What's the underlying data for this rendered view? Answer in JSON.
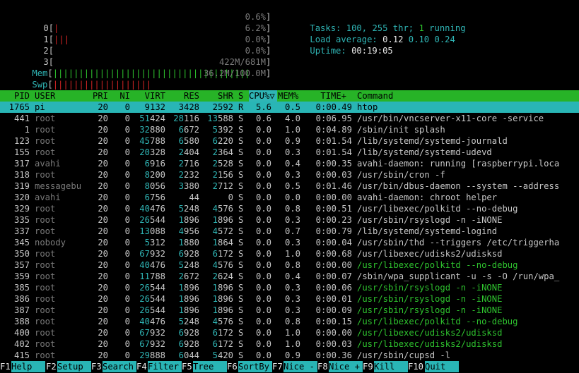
{
  "meters": {
    "cpu": [
      {
        "label": "0",
        "bar": "|",
        "pct": "0.6%"
      },
      {
        "label": "1",
        "bar": "|||",
        "pct": "6.2%"
      },
      {
        "label": "2",
        "bar": "",
        "pct": "0.0%"
      },
      {
        "label": "3",
        "bar": "",
        "pct": "0.0%"
      }
    ],
    "mem": {
      "label": "Mem",
      "bar": "||||||||||||||||||||||||||||||||||||||",
      "value": "422M/681M"
    },
    "swp": {
      "label": "Swp",
      "bar": "|||||||||||||||||||",
      "value": "36.2M/100.0M"
    }
  },
  "stats": {
    "tasks_label": "Tasks: ",
    "tasks": "100",
    "thr": "255",
    "thr_label": " thr; ",
    "running": "1",
    "running_label": " running",
    "load_label": "Load average: ",
    "load1": "0.12",
    "load5": "0.10",
    "load15": "0.24",
    "uptime_label": "Uptime: ",
    "uptime": "00:19:05"
  },
  "columns": [
    "PID",
    "USER",
    "PRI",
    "NI",
    "VIRT",
    "RES",
    "SHR",
    "S",
    "CPU%",
    "MEM%",
    "TIME+",
    "Command"
  ],
  "sort_indicator": "▽",
  "processes": [
    {
      "pid": "1765",
      "user": "pi",
      "pri": "20",
      "ni": "0",
      "virt": "9132",
      "res": "3428",
      "shr": "2592",
      "s": "R",
      "cpu": "5.6",
      "mem": "0.5",
      "time": "0:00.49",
      "cmd": "htop",
      "selected": true
    },
    {
      "pid": "441",
      "user": "root",
      "pri": "20",
      "ni": "0",
      "virt": "51424",
      "res": "28116",
      "shr": "13588",
      "s": "S",
      "cpu": "0.6",
      "mem": "4.0",
      "time": "0:06.95",
      "cmd": "/usr/bin/vncserver-x11-core -service",
      "thread": false
    },
    {
      "pid": "1",
      "user": "root",
      "pri": "20",
      "ni": "0",
      "virt": "32880",
      "res": "6672",
      "shr": "5392",
      "s": "S",
      "cpu": "0.0",
      "mem": "1.0",
      "time": "0:04.89",
      "cmd": "/sbin/init splash",
      "thread": false
    },
    {
      "pid": "123",
      "user": "root",
      "pri": "20",
      "ni": "0",
      "virt": "45788",
      "res": "6580",
      "shr": "6220",
      "s": "S",
      "cpu": "0.0",
      "mem": "0.9",
      "time": "0:01.54",
      "cmd": "/lib/systemd/systemd-journald",
      "thread": false
    },
    {
      "pid": "155",
      "user": "root",
      "pri": "20",
      "ni": "0",
      "virt": "20328",
      "res": "2404",
      "shr": "2364",
      "s": "S",
      "cpu": "0.0",
      "mem": "0.3",
      "time": "0:01.54",
      "cmd": "/lib/systemd/systemd-udevd",
      "thread": false
    },
    {
      "pid": "317",
      "user": "avahi",
      "pri": "20",
      "ni": "0",
      "virt": "6916",
      "res": "2716",
      "shr": "2528",
      "s": "S",
      "cpu": "0.0",
      "mem": "0.4",
      "time": "0:00.35",
      "cmd": "avahi-daemon: running [raspberrypi.loca",
      "thread": false
    },
    {
      "pid": "318",
      "user": "root",
      "pri": "20",
      "ni": "0",
      "virt": "8200",
      "res": "2232",
      "shr": "2156",
      "s": "S",
      "cpu": "0.0",
      "mem": "0.3",
      "time": "0:00.03",
      "cmd": "/usr/sbin/cron -f",
      "thread": false
    },
    {
      "pid": "319",
      "user": "messagebu",
      "pri": "20",
      "ni": "0",
      "virt": "8056",
      "res": "3380",
      "shr": "2712",
      "s": "S",
      "cpu": "0.0",
      "mem": "0.5",
      "time": "0:01.46",
      "cmd": "/usr/bin/dbus-daemon --system --address",
      "thread": false
    },
    {
      "pid": "320",
      "user": "avahi",
      "pri": "20",
      "ni": "0",
      "virt": "6756",
      "res": "44",
      "shr": "0",
      "s": "S",
      "cpu": "0.0",
      "mem": "0.0",
      "time": "0:00.00",
      "cmd": "avahi-daemon: chroot helper",
      "thread": false
    },
    {
      "pid": "329",
      "user": "root",
      "pri": "20",
      "ni": "0",
      "virt": "40476",
      "res": "5248",
      "shr": "4576",
      "s": "S",
      "cpu": "0.0",
      "mem": "0.8",
      "time": "0:00.51",
      "cmd": "/usr/libexec/polkitd --no-debug",
      "thread": false
    },
    {
      "pid": "335",
      "user": "root",
      "pri": "20",
      "ni": "0",
      "virt": "26544",
      "res": "1896",
      "shr": "1896",
      "s": "S",
      "cpu": "0.0",
      "mem": "0.3",
      "time": "0:00.23",
      "cmd": "/usr/sbin/rsyslogd -n -iNONE",
      "thread": false
    },
    {
      "pid": "337",
      "user": "root",
      "pri": "20",
      "ni": "0",
      "virt": "13088",
      "res": "4956",
      "shr": "4572",
      "s": "S",
      "cpu": "0.0",
      "mem": "0.7",
      "time": "0:00.79",
      "cmd": "/lib/systemd/systemd-logind",
      "thread": false
    },
    {
      "pid": "345",
      "user": "nobody",
      "pri": "20",
      "ni": "0",
      "virt": "5312",
      "res": "1880",
      "shr": "1864",
      "s": "S",
      "cpu": "0.0",
      "mem": "0.3",
      "time": "0:00.04",
      "cmd": "/usr/sbin/thd --triggers /etc/triggerha",
      "thread": false
    },
    {
      "pid": "350",
      "user": "root",
      "pri": "20",
      "ni": "0",
      "virt": "67932",
      "res": "6928",
      "shr": "6172",
      "s": "S",
      "cpu": "0.0",
      "mem": "1.0",
      "time": "0:00.68",
      "cmd": "/usr/libexec/udisks2/udisksd",
      "thread": false
    },
    {
      "pid": "357",
      "user": "root",
      "pri": "20",
      "ni": "0",
      "virt": "40476",
      "res": "5248",
      "shr": "4576",
      "s": "S",
      "cpu": "0.0",
      "mem": "0.8",
      "time": "0:00.00",
      "cmd": "/usr/libexec/polkitd --no-debug",
      "thread": true
    },
    {
      "pid": "359",
      "user": "root",
      "pri": "20",
      "ni": "0",
      "virt": "11788",
      "res": "2672",
      "shr": "2624",
      "s": "S",
      "cpu": "0.0",
      "mem": "0.4",
      "time": "0:00.07",
      "cmd": "/sbin/wpa_supplicant -u -s -O /run/wpa_",
      "thread": false
    },
    {
      "pid": "385",
      "user": "root",
      "pri": "20",
      "ni": "0",
      "virt": "26544",
      "res": "1896",
      "shr": "1896",
      "s": "S",
      "cpu": "0.0",
      "mem": "0.3",
      "time": "0:00.06",
      "cmd": "/usr/sbin/rsyslogd -n -iNONE",
      "thread": true
    },
    {
      "pid": "386",
      "user": "root",
      "pri": "20",
      "ni": "0",
      "virt": "26544",
      "res": "1896",
      "shr": "1896",
      "s": "S",
      "cpu": "0.0",
      "mem": "0.3",
      "time": "0:00.01",
      "cmd": "/usr/sbin/rsyslogd -n -iNONE",
      "thread": true
    },
    {
      "pid": "387",
      "user": "root",
      "pri": "20",
      "ni": "0",
      "virt": "26544",
      "res": "1896",
      "shr": "1896",
      "s": "S",
      "cpu": "0.0",
      "mem": "0.3",
      "time": "0:00.09",
      "cmd": "/usr/sbin/rsyslogd -n -iNONE",
      "thread": true
    },
    {
      "pid": "388",
      "user": "root",
      "pri": "20",
      "ni": "0",
      "virt": "40476",
      "res": "5248",
      "shr": "4576",
      "s": "S",
      "cpu": "0.0",
      "mem": "0.8",
      "time": "0:00.15",
      "cmd": "/usr/libexec/polkitd --no-debug",
      "thread": true
    },
    {
      "pid": "400",
      "user": "root",
      "pri": "20",
      "ni": "0",
      "virt": "67932",
      "res": "6928",
      "shr": "6172",
      "s": "S",
      "cpu": "0.0",
      "mem": "1.0",
      "time": "0:00.00",
      "cmd": "/usr/libexec/udisks2/udisksd",
      "thread": true
    },
    {
      "pid": "402",
      "user": "root",
      "pri": "20",
      "ni": "0",
      "virt": "67932",
      "res": "6928",
      "shr": "6172",
      "s": "S",
      "cpu": "0.0",
      "mem": "1.0",
      "time": "0:00.03",
      "cmd": "/usr/libexec/udisks2/udisksd",
      "thread": true
    },
    {
      "pid": "415",
      "user": "root",
      "pri": "20",
      "ni": "0",
      "virt": "29888",
      "res": "6044",
      "shr": "5420",
      "s": "S",
      "cpu": "0.0",
      "mem": "0.9",
      "time": "0:00.36",
      "cmd": "/usr/sbin/cupsd -l",
      "thread": false
    }
  ],
  "footer": [
    {
      "key": "F1",
      "label": "Help"
    },
    {
      "key": "F2",
      "label": "Setup"
    },
    {
      "key": "F3",
      "label": "Search"
    },
    {
      "key": "F4",
      "label": "Filter"
    },
    {
      "key": "F5",
      "label": "Tree"
    },
    {
      "key": "F6",
      "label": "SortBy"
    },
    {
      "key": "F7",
      "label": "Nice -"
    },
    {
      "key": "F8",
      "label": "Nice +"
    },
    {
      "key": "F9",
      "label": "Kill"
    },
    {
      "key": "F10",
      "label": "Quit"
    }
  ],
  "colors": {
    "background": "#000000",
    "header_bg": "#27b327",
    "selected_bg": "#29b5b5",
    "cyan": "#2fb5b5",
    "green": "#2ec22e",
    "red": "#d22424"
  }
}
